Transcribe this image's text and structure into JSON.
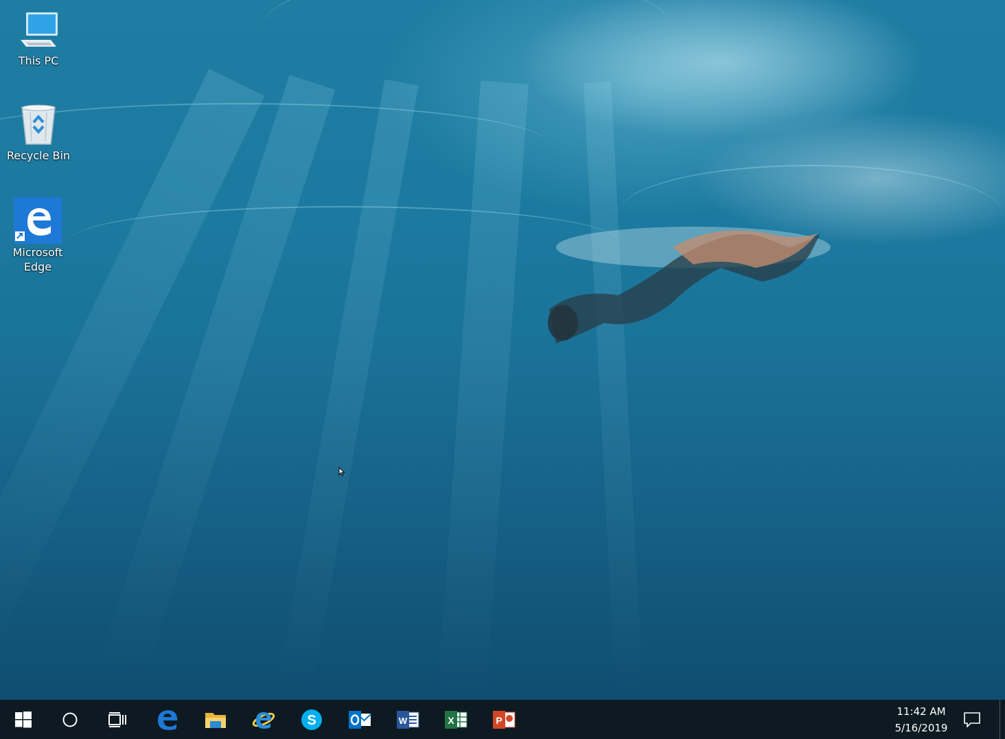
{
  "desktop": {
    "icons": [
      {
        "label": "This PC",
        "icon": "computer-icon"
      },
      {
        "label": "Recycle Bin",
        "icon": "recycle-bin-icon"
      },
      {
        "label_line1": "Microsoft",
        "label_line2": "Edge",
        "icon": "edge-icon"
      }
    ]
  },
  "taskbar": {
    "buttons": [
      {
        "name": "start",
        "icon": "windows-logo-icon"
      },
      {
        "name": "cortana",
        "icon": "search-circle-icon"
      },
      {
        "name": "task-view",
        "icon": "task-view-icon"
      },
      {
        "name": "edge",
        "icon": "edge-icon"
      },
      {
        "name": "file-explorer",
        "icon": "folder-icon"
      },
      {
        "name": "internet-explorer",
        "icon": "ie-icon"
      },
      {
        "name": "skype",
        "icon": "skype-icon",
        "letter": "S"
      },
      {
        "name": "outlook",
        "icon": "outlook-icon",
        "letter": "O"
      },
      {
        "name": "word",
        "icon": "word-icon",
        "letter": "W"
      },
      {
        "name": "excel",
        "icon": "excel-icon",
        "letter": "X"
      },
      {
        "name": "powerpoint",
        "icon": "powerpoint-icon",
        "letter": "P"
      }
    ],
    "clock": {
      "time": "11:42 AM",
      "date": "5/16/2019"
    },
    "notification_icon": "action-center-icon"
  },
  "colors": {
    "taskbar_bg": "#0d1a22",
    "edge_blue": "#1565c0",
    "skype_blue": "#00aff0",
    "outlook_blue": "#0072c6",
    "word_blue": "#2b579a",
    "excel_green": "#217346",
    "powerpoint_orange": "#d24726",
    "folder_yellow": "#f2c94c"
  }
}
